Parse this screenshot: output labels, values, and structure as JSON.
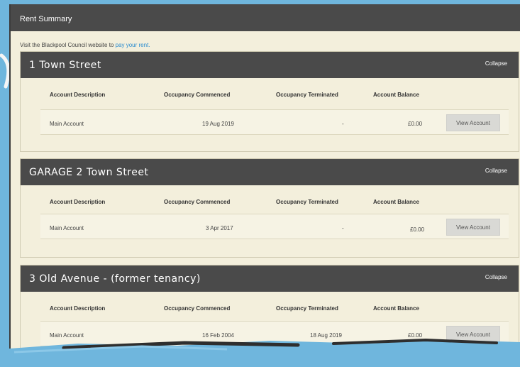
{
  "panel": {
    "title": "Rent Summary",
    "intro_text": "Visit the Blackpool Council website to",
    "intro_link": "pay your rent."
  },
  "columns": {
    "description": "Account Description",
    "commenced": "Occupancy Commenced",
    "terminated": "Occupancy Terminated",
    "balance": "Account Balance"
  },
  "tenancies": [
    {
      "title": "1 Town Street",
      "collapse_label": "Collapse",
      "row": {
        "description": "Main Account",
        "commenced": "19 Aug 2019",
        "terminated": "-",
        "balance": "£0.00",
        "button": "View Account"
      }
    },
    {
      "title": "GARAGE 2 Town Street",
      "collapse_label": "Collapse",
      "row": {
        "description": "Main Account",
        "commenced": "3 Apr 2017",
        "terminated": "-",
        "balance": "£0.00",
        "button": "View Account"
      }
    },
    {
      "title": "3 Old Avenue - (former tenancy)",
      "collapse_label": "Collapse",
      "row": {
        "description": "Main Account",
        "commenced": "16 Feb 2004",
        "terminated": "18 Aug 2019",
        "balance": "£0.00",
        "button": "View Account"
      }
    }
  ],
  "colors": {
    "background": "#6fb6dd",
    "panel": "#f3efdc",
    "header": "#4a4a4a",
    "link": "#2a8ccf"
  }
}
